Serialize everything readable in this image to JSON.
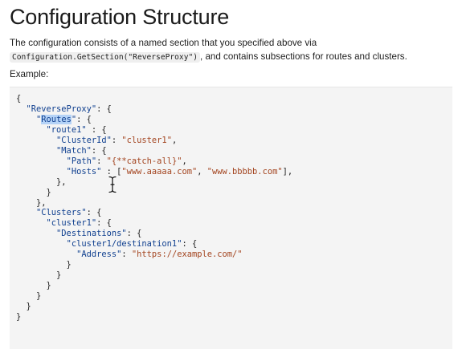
{
  "heading": "Configuration Structure",
  "intro": {
    "text_before": "The configuration consists of a named section that you specified above via",
    "code": "Configuration.GetSection(\"ReverseProxy\")",
    "text_after": ", and contains subsections for routes and clusters."
  },
  "example_label": "Example:",
  "code_lines": [
    [
      {
        "t": "p",
        "v": "{"
      }
    ],
    [
      {
        "t": "p",
        "v": "  "
      },
      {
        "t": "k",
        "v": "\"ReverseProxy\""
      },
      {
        "t": "p",
        "v": ": {"
      }
    ],
    [
      {
        "t": "p",
        "v": "    "
      },
      {
        "t": "k",
        "v": "\""
      },
      {
        "t": "h",
        "v": "Routes"
      },
      {
        "t": "k",
        "v": "\""
      },
      {
        "t": "p",
        "v": ": {"
      }
    ],
    [
      {
        "t": "p",
        "v": "      "
      },
      {
        "t": "k",
        "v": "\"route1\""
      },
      {
        "t": "p",
        "v": " : {"
      }
    ],
    [
      {
        "t": "p",
        "v": "        "
      },
      {
        "t": "k",
        "v": "\"ClusterId\""
      },
      {
        "t": "p",
        "v": ": "
      },
      {
        "t": "s",
        "v": "\"cluster1\""
      },
      {
        "t": "p",
        "v": ","
      }
    ],
    [
      {
        "t": "p",
        "v": "        "
      },
      {
        "t": "k",
        "v": "\"Match\""
      },
      {
        "t": "p",
        "v": ": {"
      }
    ],
    [
      {
        "t": "p",
        "v": "          "
      },
      {
        "t": "k",
        "v": "\"Path\""
      },
      {
        "t": "p",
        "v": ": "
      },
      {
        "t": "s",
        "v": "\"{**catch-all}\""
      },
      {
        "t": "p",
        "v": ","
      }
    ],
    [
      {
        "t": "p",
        "v": "          "
      },
      {
        "t": "k",
        "v": "\"Hosts\""
      },
      {
        "t": "p",
        "v": " : ["
      },
      {
        "t": "s",
        "v": "\"www.aaaaa.com\""
      },
      {
        "t": "p",
        "v": ", "
      },
      {
        "t": "s",
        "v": "\"www.bbbbb.com\""
      },
      {
        "t": "p",
        "v": "],"
      }
    ],
    [
      {
        "t": "p",
        "v": "        },"
      }
    ],
    [
      {
        "t": "p",
        "v": "      }"
      }
    ],
    [
      {
        "t": "p",
        "v": "    },"
      }
    ],
    [
      {
        "t": "p",
        "v": "    "
      },
      {
        "t": "k",
        "v": "\"Clusters\""
      },
      {
        "t": "p",
        "v": ": {"
      }
    ],
    [
      {
        "t": "p",
        "v": "      "
      },
      {
        "t": "k",
        "v": "\"cluster1\""
      },
      {
        "t": "p",
        "v": ": {"
      }
    ],
    [
      {
        "t": "p",
        "v": "        "
      },
      {
        "t": "k",
        "v": "\"Destinations\""
      },
      {
        "t": "p",
        "v": ": {"
      }
    ],
    [
      {
        "t": "p",
        "v": "          "
      },
      {
        "t": "k",
        "v": "\"cluster1/destination1\""
      },
      {
        "t": "p",
        "v": ": {"
      }
    ],
    [
      {
        "t": "p",
        "v": "            "
      },
      {
        "t": "k",
        "v": "\"Address\""
      },
      {
        "t": "p",
        "v": ": "
      },
      {
        "t": "s",
        "v": "\"https://example.com/\""
      }
    ],
    [
      {
        "t": "p",
        "v": "          }"
      }
    ],
    [
      {
        "t": "p",
        "v": "        }"
      }
    ],
    [
      {
        "t": "p",
        "v": "      }"
      }
    ],
    [
      {
        "t": "p",
        "v": "    }"
      }
    ],
    [
      {
        "t": "p",
        "v": "  }"
      }
    ],
    [
      {
        "t": "p",
        "v": "}"
      }
    ]
  ],
  "colors": {
    "key": "#0f3f8f",
    "string": "#a3441f",
    "selection": "#b5d3f7",
    "code_background": "#f4f4f4"
  },
  "cursor_icon": "text-cursor-icon"
}
